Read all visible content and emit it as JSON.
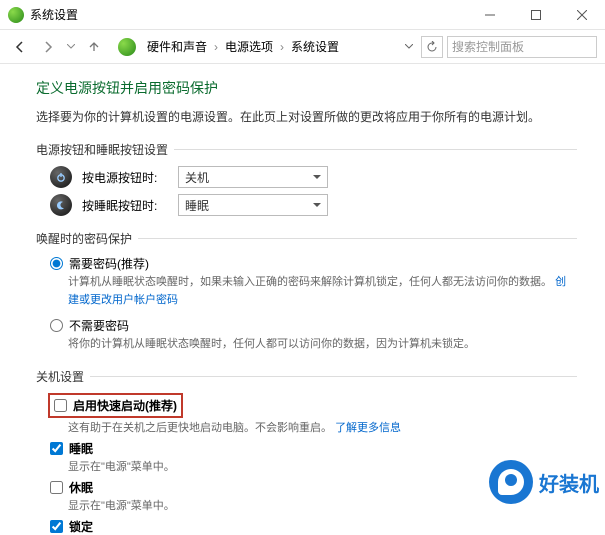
{
  "window": {
    "title": "系统设置"
  },
  "nav": {
    "search_placeholder": "搜索控制面板",
    "crumbs": [
      "硬件和声音",
      "电源选项",
      "系统设置"
    ]
  },
  "page": {
    "title": "定义电源按钮并启用密码保护",
    "desc": "选择要为你的计算机设置的电源设置。在此页上对设置所做的更改将应用于你所有的电源计划。"
  },
  "group_buttons": {
    "heading": "电源按钮和睡眠按钮设置",
    "rows": [
      {
        "label": "按电源按钮时:",
        "value": "关机"
      },
      {
        "label": "按睡眠按钮时:",
        "value": "睡眠"
      }
    ]
  },
  "group_wake": {
    "heading": "唤醒时的密码保护",
    "opt_require": {
      "label": "需要密码(推荐)",
      "desc_prefix": "计算机从睡眠状态唤醒时，如果未输入正确的密码来解除计算机锁定，任何人都无法访问你的数据。",
      "link": "创建或更改用户帐户密码"
    },
    "opt_norequire": {
      "label": "不需要密码",
      "desc": "将你的计算机从睡眠状态唤醒时，任何人都可以访问你的数据，因为计算机未锁定。"
    }
  },
  "group_shutdown": {
    "heading": "关机设置",
    "fastboot": {
      "label": "启用快速启动(推荐)",
      "desc_prefix": "这有助于在关机之后更快地启动电脑。不会影响重启。",
      "link": "了解更多信息"
    },
    "sleep": {
      "label": "睡眠",
      "desc": "显示在\"电源\"菜单中。"
    },
    "hibernate": {
      "label": "休眠",
      "desc": "显示在\"电源\"菜单中。"
    },
    "lock": {
      "label": "锁定"
    }
  },
  "watermark": {
    "text": "好装机"
  }
}
